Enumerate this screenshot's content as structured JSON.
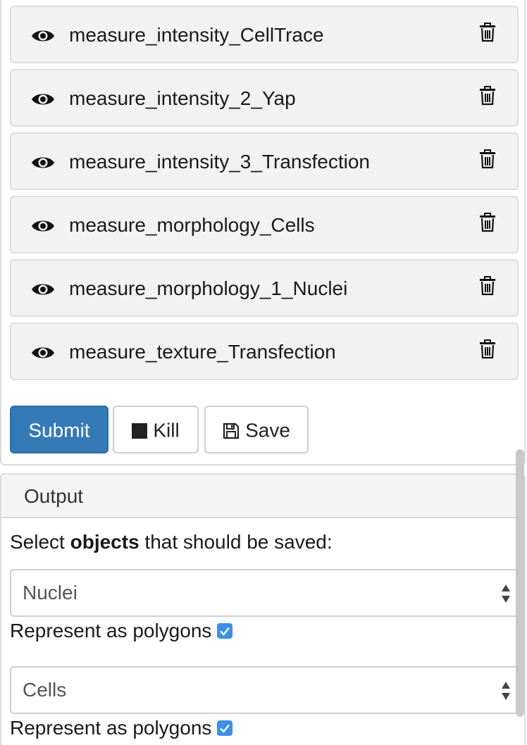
{
  "jobs": [
    {
      "label": "measure_intensity_CellTrace",
      "eye_icon": "eye-icon",
      "delete_icon": "trash-icon"
    },
    {
      "label": "measure_intensity_2_Yap",
      "eye_icon": "eye-icon",
      "delete_icon": "trash-icon"
    },
    {
      "label": "measure_intensity_3_Transfection",
      "eye_icon": "eye-icon",
      "delete_icon": "trash-icon"
    },
    {
      "label": "measure_morphology_Cells",
      "eye_icon": "eye-icon",
      "delete_icon": "trash-icon"
    },
    {
      "label": "measure_morphology_1_Nuclei",
      "eye_icon": "eye-icon",
      "delete_icon": "trash-icon"
    },
    {
      "label": "measure_texture_Transfection",
      "eye_icon": "eye-icon",
      "delete_icon": "trash-icon"
    }
  ],
  "actions": {
    "submit_label": "Submit",
    "kill_label": "Kill",
    "kill_icon": "stop-square-icon",
    "save_label": "Save",
    "save_icon": "floppy-disk-icon"
  },
  "output": {
    "title": "Output",
    "prompt_prefix": "Select ",
    "prompt_bold": "objects",
    "prompt_suffix": " that should be saved:",
    "objects": [
      {
        "selected": "Nuclei",
        "checkbox_label": "Represent as polygons",
        "checked": true
      },
      {
        "selected": "Cells",
        "checkbox_label": "Represent as polygons",
        "checked": true
      }
    ]
  },
  "colors": {
    "primary": "#337ab7",
    "checkbox": "#3d8fe8",
    "panel_bg": "#f2f2f2",
    "border": "#dcdcdc"
  }
}
